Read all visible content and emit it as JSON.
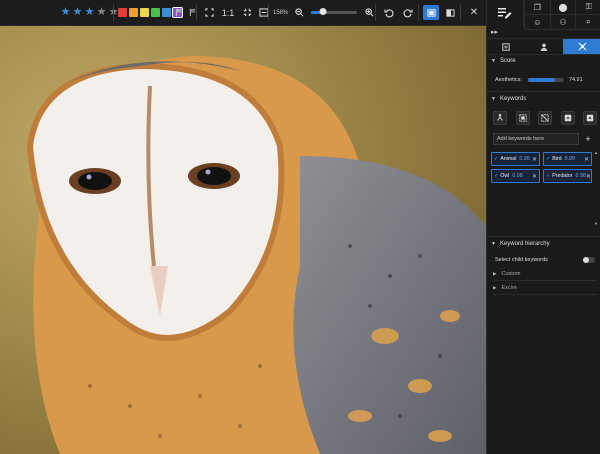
{
  "toolbar": {
    "rating": {
      "value": 3,
      "max": 5
    },
    "color_labels": [
      "#e23b3b",
      "#f0a030",
      "#e8d84a",
      "#4bbf4b",
      "#3b8fd9",
      "#8a4bd6"
    ],
    "selected_color": 5,
    "flag_icons": [
      "pick-flag-icon",
      "reject-flag-icon"
    ],
    "fit_icon": "fit-screen-icon",
    "actual_size_label": "1:1",
    "center_icon": "center-icon",
    "fill_icon": "fill-screen-icon",
    "zoom_text": "158%",
    "zoom_level": 0.25,
    "rotate_left_icon": "rotate-left-icon",
    "rotate_right_icon": "rotate-right-icon",
    "view_single_icon": "single-view-icon",
    "view_compare_icon": "compare-view-icon",
    "close_icon": "close-icon"
  },
  "panel": {
    "header_icons": [
      "copy-icon",
      "location-icon",
      "key-icon",
      "face-icon",
      "people-icon",
      "search-icon"
    ],
    "tabs": [
      "info-tab-icon",
      "person-tab-icon",
      "ai-tab-icon"
    ],
    "active_tab": 2,
    "score": {
      "title": "Score",
      "label": "Aesthetics:",
      "value_text": "74.91",
      "value": 0.7491
    },
    "keywords": {
      "title": "Keywords",
      "placeholder": "Add keywords here",
      "items": [
        {
          "name": "Animal",
          "conf": "0.99"
        },
        {
          "name": "Bird",
          "conf": "0.99"
        },
        {
          "name": "Owl",
          "conf": "0.98"
        },
        {
          "name": "Predator",
          "conf": "0.98"
        }
      ]
    },
    "hierarchy": {
      "title": "Keyword hierarchy",
      "select_child": "Select child keywords",
      "items": [
        "Custom",
        "Excire"
      ]
    }
  },
  "colors": {
    "accent": "#2e7bd1",
    "panel_bg": "#1a1a1a",
    "toolbar_bg": "#1c1c1c"
  }
}
